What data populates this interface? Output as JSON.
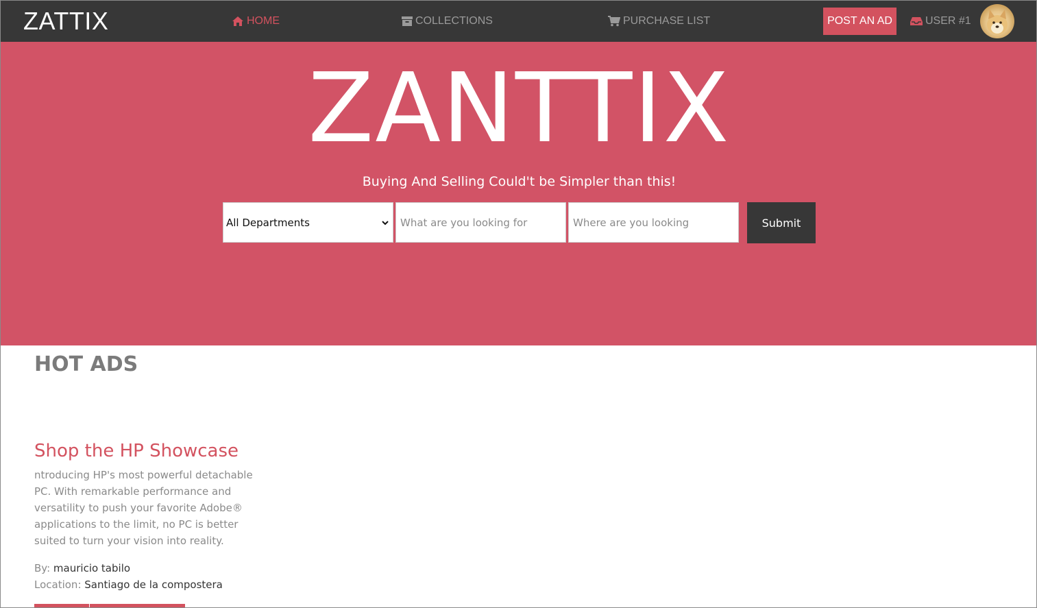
{
  "navbar": {
    "brand": "ZATTIX",
    "links": [
      {
        "label": "HOME",
        "icon": "home-icon",
        "active": true
      },
      {
        "label": "COLLECTIONS",
        "icon": "archive-icon",
        "active": false
      },
      {
        "label": "PURCHASE LIST",
        "icon": "cart-icon",
        "active": false
      }
    ],
    "post_ad": "POST AN AD",
    "user": {
      "label": "USER #1",
      "icon": "inbox-icon"
    }
  },
  "hero": {
    "title": "ZANTTIX",
    "subtitle": "Buying And Selling Could't be Simpler than this!",
    "department_select": {
      "selected": "All Departments"
    },
    "what_placeholder": "What are you looking for",
    "where_placeholder": "Where are you looking",
    "submit_label": "Submit"
  },
  "section": {
    "title": "HOT ADS"
  },
  "ad": {
    "title": "Shop the HP Showcase",
    "description": "ntroducing HP's most powerful detachable PC. With remarkable performance and versatility to push your favorite Adobe® applications to the limit, no PC is better suited to turn your vision into reality.",
    "by_label": "By:",
    "by_value": "mauricio tabilo",
    "location_label": "Location:",
    "location_value": "Santiago de la compostera"
  },
  "colors": {
    "accent": "#d3525f",
    "hero_bg": "#d25366",
    "navbar_bg": "#373737"
  }
}
